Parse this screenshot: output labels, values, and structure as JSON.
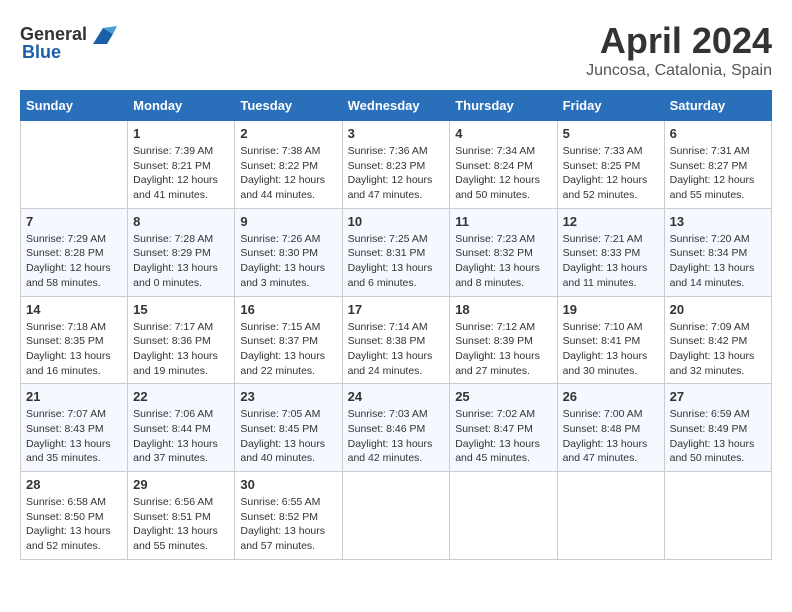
{
  "header": {
    "logo_general": "General",
    "logo_blue": "Blue",
    "month": "April 2024",
    "location": "Juncosa, Catalonia, Spain"
  },
  "days_of_week": [
    "Sunday",
    "Monday",
    "Tuesday",
    "Wednesday",
    "Thursday",
    "Friday",
    "Saturday"
  ],
  "weeks": [
    [
      {
        "day": "",
        "info": ""
      },
      {
        "day": "1",
        "info": "Sunrise: 7:39 AM\nSunset: 8:21 PM\nDaylight: 12 hours\nand 41 minutes."
      },
      {
        "day": "2",
        "info": "Sunrise: 7:38 AM\nSunset: 8:22 PM\nDaylight: 12 hours\nand 44 minutes."
      },
      {
        "day": "3",
        "info": "Sunrise: 7:36 AM\nSunset: 8:23 PM\nDaylight: 12 hours\nand 47 minutes."
      },
      {
        "day": "4",
        "info": "Sunrise: 7:34 AM\nSunset: 8:24 PM\nDaylight: 12 hours\nand 50 minutes."
      },
      {
        "day": "5",
        "info": "Sunrise: 7:33 AM\nSunset: 8:25 PM\nDaylight: 12 hours\nand 52 minutes."
      },
      {
        "day": "6",
        "info": "Sunrise: 7:31 AM\nSunset: 8:27 PM\nDaylight: 12 hours\nand 55 minutes."
      }
    ],
    [
      {
        "day": "7",
        "info": "Sunrise: 7:29 AM\nSunset: 8:28 PM\nDaylight: 12 hours\nand 58 minutes."
      },
      {
        "day": "8",
        "info": "Sunrise: 7:28 AM\nSunset: 8:29 PM\nDaylight: 13 hours\nand 0 minutes."
      },
      {
        "day": "9",
        "info": "Sunrise: 7:26 AM\nSunset: 8:30 PM\nDaylight: 13 hours\nand 3 minutes."
      },
      {
        "day": "10",
        "info": "Sunrise: 7:25 AM\nSunset: 8:31 PM\nDaylight: 13 hours\nand 6 minutes."
      },
      {
        "day": "11",
        "info": "Sunrise: 7:23 AM\nSunset: 8:32 PM\nDaylight: 13 hours\nand 8 minutes."
      },
      {
        "day": "12",
        "info": "Sunrise: 7:21 AM\nSunset: 8:33 PM\nDaylight: 13 hours\nand 11 minutes."
      },
      {
        "day": "13",
        "info": "Sunrise: 7:20 AM\nSunset: 8:34 PM\nDaylight: 13 hours\nand 14 minutes."
      }
    ],
    [
      {
        "day": "14",
        "info": "Sunrise: 7:18 AM\nSunset: 8:35 PM\nDaylight: 13 hours\nand 16 minutes."
      },
      {
        "day": "15",
        "info": "Sunrise: 7:17 AM\nSunset: 8:36 PM\nDaylight: 13 hours\nand 19 minutes."
      },
      {
        "day": "16",
        "info": "Sunrise: 7:15 AM\nSunset: 8:37 PM\nDaylight: 13 hours\nand 22 minutes."
      },
      {
        "day": "17",
        "info": "Sunrise: 7:14 AM\nSunset: 8:38 PM\nDaylight: 13 hours\nand 24 minutes."
      },
      {
        "day": "18",
        "info": "Sunrise: 7:12 AM\nSunset: 8:39 PM\nDaylight: 13 hours\nand 27 minutes."
      },
      {
        "day": "19",
        "info": "Sunrise: 7:10 AM\nSunset: 8:41 PM\nDaylight: 13 hours\nand 30 minutes."
      },
      {
        "day": "20",
        "info": "Sunrise: 7:09 AM\nSunset: 8:42 PM\nDaylight: 13 hours\nand 32 minutes."
      }
    ],
    [
      {
        "day": "21",
        "info": "Sunrise: 7:07 AM\nSunset: 8:43 PM\nDaylight: 13 hours\nand 35 minutes."
      },
      {
        "day": "22",
        "info": "Sunrise: 7:06 AM\nSunset: 8:44 PM\nDaylight: 13 hours\nand 37 minutes."
      },
      {
        "day": "23",
        "info": "Sunrise: 7:05 AM\nSunset: 8:45 PM\nDaylight: 13 hours\nand 40 minutes."
      },
      {
        "day": "24",
        "info": "Sunrise: 7:03 AM\nSunset: 8:46 PM\nDaylight: 13 hours\nand 42 minutes."
      },
      {
        "day": "25",
        "info": "Sunrise: 7:02 AM\nSunset: 8:47 PM\nDaylight: 13 hours\nand 45 minutes."
      },
      {
        "day": "26",
        "info": "Sunrise: 7:00 AM\nSunset: 8:48 PM\nDaylight: 13 hours\nand 47 minutes."
      },
      {
        "day": "27",
        "info": "Sunrise: 6:59 AM\nSunset: 8:49 PM\nDaylight: 13 hours\nand 50 minutes."
      }
    ],
    [
      {
        "day": "28",
        "info": "Sunrise: 6:58 AM\nSunset: 8:50 PM\nDaylight: 13 hours\nand 52 minutes."
      },
      {
        "day": "29",
        "info": "Sunrise: 6:56 AM\nSunset: 8:51 PM\nDaylight: 13 hours\nand 55 minutes."
      },
      {
        "day": "30",
        "info": "Sunrise: 6:55 AM\nSunset: 8:52 PM\nDaylight: 13 hours\nand 57 minutes."
      },
      {
        "day": "",
        "info": ""
      },
      {
        "day": "",
        "info": ""
      },
      {
        "day": "",
        "info": ""
      },
      {
        "day": "",
        "info": ""
      }
    ]
  ]
}
